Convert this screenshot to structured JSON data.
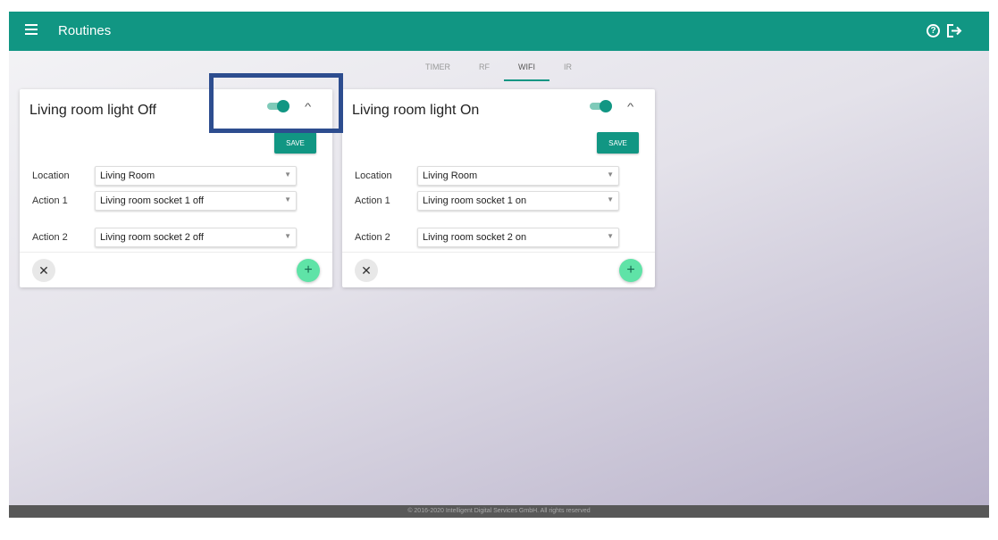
{
  "header": {
    "title": "Routines",
    "menu_icon": "menu-icon",
    "help_icon": "help-icon",
    "logout_icon": "logout-icon"
  },
  "tabs": [
    {
      "label": "TIMER",
      "active": false
    },
    {
      "label": "RF",
      "active": false
    },
    {
      "label": "WIFI",
      "active": true
    },
    {
      "label": "IR",
      "active": false
    }
  ],
  "cards": [
    {
      "title": "Living room light Off",
      "enabled": true,
      "save_label": "SAVE",
      "location_label": "Location",
      "location_value": "Living Room",
      "actions": [
        {
          "label": "Action 1",
          "value": "Living room socket 1 off"
        },
        {
          "label": "Action 2",
          "value": "Living room socket 2 off"
        }
      ]
    },
    {
      "title": "Living room light On",
      "enabled": true,
      "save_label": "SAVE",
      "location_label": "Location",
      "location_value": "Living Room",
      "actions": [
        {
          "label": "Action 1",
          "value": "Living room socket 1 on"
        },
        {
          "label": "Action 2",
          "value": "Living room socket 2 on"
        }
      ]
    }
  ],
  "footer": {
    "text": "© 2016-2020 Intelligent Digital Services GmbH. All rights reserved"
  },
  "colors": {
    "primary": "#119683",
    "fab": "#5fe3a7",
    "highlight": "#2d4d8f"
  }
}
